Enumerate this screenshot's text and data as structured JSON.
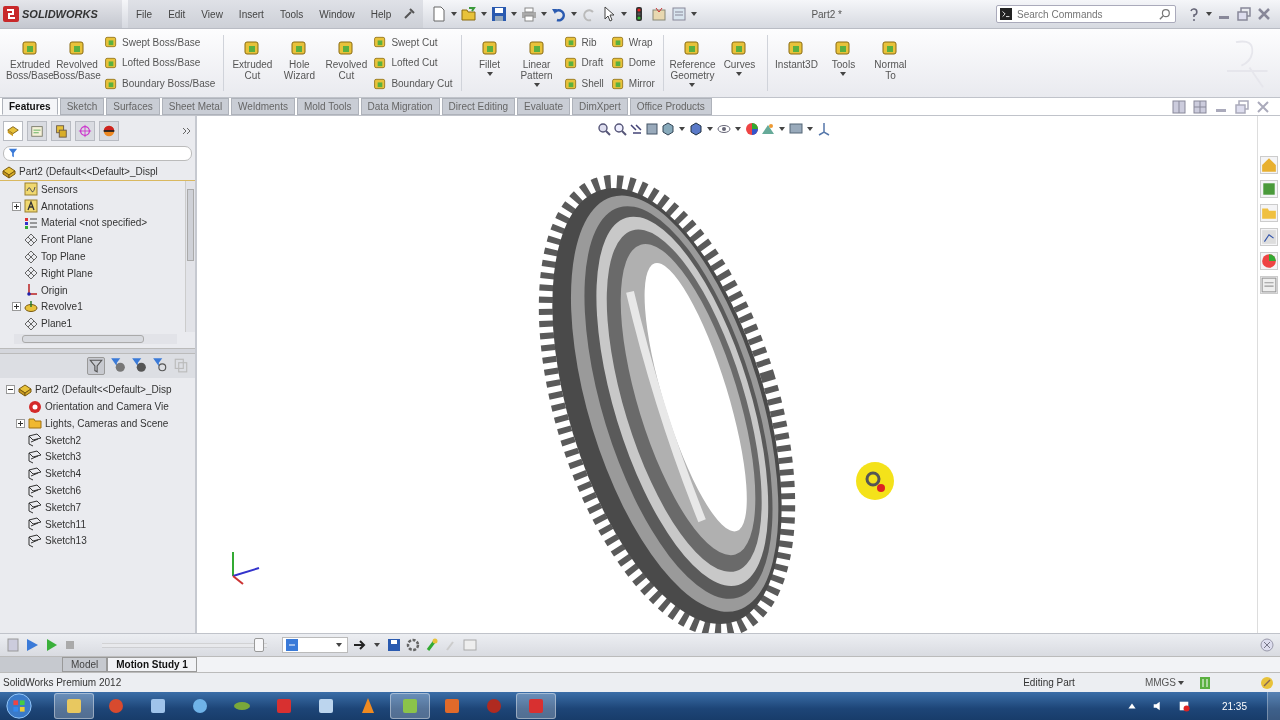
{
  "window": {
    "logo": "SOLIDWORKS",
    "title": "Part2 *"
  },
  "menu": [
    "File",
    "Edit",
    "View",
    "Insert",
    "Tools",
    "Window",
    "Help"
  ],
  "search": {
    "placeholder": "Search Commands"
  },
  "ribbon": [
    {
      "items": [
        {
          "kind": "large",
          "label": "Extruded Boss/Base",
          "menu": false
        },
        {
          "kind": "large",
          "label": "Revolved Boss/Base",
          "menu": false
        },
        {
          "kind": "stack",
          "entries": [
            "Swept Boss/Base",
            "Lofted Boss/Base",
            "Boundary Boss/Base"
          ]
        }
      ]
    },
    {
      "items": [
        {
          "kind": "large",
          "label": "Extruded Cut",
          "menu": false
        },
        {
          "kind": "large",
          "label": "Hole Wizard",
          "menu": false
        },
        {
          "kind": "large",
          "label": "Revolved Cut",
          "menu": false
        },
        {
          "kind": "stack",
          "entries": [
            "Swept Cut",
            "Lofted Cut",
            "Boundary Cut"
          ]
        }
      ]
    },
    {
      "items": [
        {
          "kind": "large",
          "label": "Fillet",
          "menu": true
        },
        {
          "kind": "large",
          "label": "Linear Pattern",
          "menu": true
        },
        {
          "kind": "stack",
          "entries": [
            "Rib",
            "Draft",
            "Shell"
          ]
        },
        {
          "kind": "stack",
          "entries": [
            "Wrap",
            "Dome",
            "Mirror"
          ]
        }
      ]
    },
    {
      "items": [
        {
          "kind": "large",
          "label": "Reference Geometry",
          "menu": true
        },
        {
          "kind": "large",
          "label": "Curves",
          "menu": true
        }
      ]
    },
    {
      "items": [
        {
          "kind": "large",
          "label": "Instant3D",
          "menu": false
        },
        {
          "kind": "large",
          "label": "Tools",
          "menu": true
        },
        {
          "kind": "large",
          "label": "Normal To",
          "menu": false
        }
      ]
    }
  ],
  "command_tabs": [
    {
      "label": "Features",
      "selected": true
    },
    {
      "label": "Sketch",
      "selected": false
    },
    {
      "label": "Surfaces",
      "selected": false
    },
    {
      "label": "Sheet Metal",
      "selected": false
    },
    {
      "label": "Weldments",
      "selected": false
    },
    {
      "label": "Mold Tools",
      "selected": false
    },
    {
      "label": "Data Migration",
      "selected": false
    },
    {
      "label": "Direct Editing",
      "selected": false
    },
    {
      "label": "Evaluate",
      "selected": false
    },
    {
      "label": "DimXpert",
      "selected": false
    },
    {
      "label": "Office Products",
      "selected": false
    }
  ],
  "feature_tree": {
    "root": {
      "label": "Part2  (Default<<Default>_Displ",
      "kind": "part",
      "children": [
        {
          "label": "Sensors",
          "kind": "sensor",
          "collapsed": false
        },
        {
          "label": "Annotations",
          "kind": "annotation",
          "collapsed": true
        },
        {
          "label": "Material <not specified>",
          "kind": "material",
          "collapsed": false
        },
        {
          "label": "Front Plane",
          "kind": "plane",
          "collapsed": false
        },
        {
          "label": "Top Plane",
          "kind": "plane",
          "collapsed": false
        },
        {
          "label": "Right Plane",
          "kind": "plane",
          "collapsed": false
        },
        {
          "label": "Origin",
          "kind": "origin",
          "collapsed": false
        },
        {
          "label": "Revolve1",
          "kind": "feature",
          "collapsed": true
        },
        {
          "label": "Plane1",
          "kind": "plane",
          "collapsed": false
        }
      ]
    }
  },
  "motion_tree": {
    "root": {
      "label": "Part2  (Default<<Default>_Disp",
      "kind": "part",
      "expanded": true,
      "children": [
        {
          "label": "Orientation and Camera Vie",
          "kind": "camera",
          "collapsed": false
        },
        {
          "label": "Lights, Cameras and Scene",
          "kind": "lights",
          "collapsed": true
        },
        {
          "label": "Sketch2",
          "kind": "sketch",
          "collapsed": false
        },
        {
          "label": "Sketch3",
          "kind": "sketch",
          "collapsed": false
        },
        {
          "label": "Sketch4",
          "kind": "sketch",
          "collapsed": false
        },
        {
          "label": "Sketch6",
          "kind": "sketch",
          "collapsed": false
        },
        {
          "label": "Sketch7",
          "kind": "sketch",
          "collapsed": false
        },
        {
          "label": "Sketch11",
          "kind": "sketch",
          "collapsed": false
        },
        {
          "label": "Sketch13",
          "kind": "sketch",
          "collapsed": false
        }
      ]
    }
  },
  "motion_toolbar": {
    "timeline": {
      "level": 0.98
    }
  },
  "bottom_tabs": [
    {
      "label": "Model",
      "selected": false
    },
    {
      "label": "Motion Study 1",
      "selected": true
    }
  ],
  "status_bar": {
    "product": "SolidWorks Premium 2012",
    "mode": "Editing Part",
    "units": "MMGS"
  },
  "taskbar": {
    "apps": [
      {
        "kind": "folder",
        "running": true
      },
      {
        "kind": "browser",
        "running": false
      },
      {
        "kind": "document",
        "running": false
      },
      {
        "kind": "globe",
        "running": false
      },
      {
        "kind": "leaf",
        "running": false
      },
      {
        "kind": "red-app",
        "running": false
      },
      {
        "kind": "notepad",
        "running": false
      },
      {
        "kind": "cone",
        "running": false
      },
      {
        "kind": "sheet",
        "running": true
      },
      {
        "kind": "slides",
        "running": false
      },
      {
        "kind": "disc",
        "running": false
      },
      {
        "kind": "red-app",
        "running": true
      }
    ],
    "clock": "21:35"
  }
}
